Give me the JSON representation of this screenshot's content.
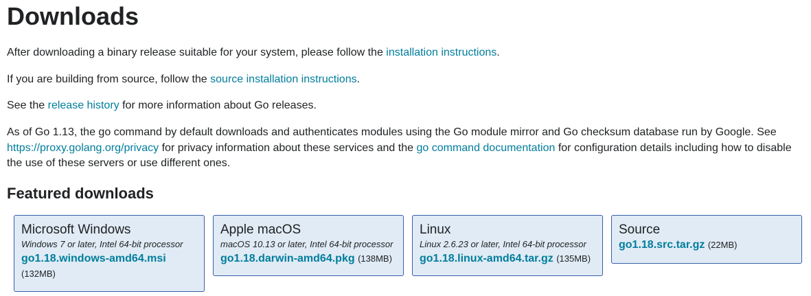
{
  "page_title": "Downloads",
  "intro": {
    "before": "After downloading a binary release suitable for your system, please follow the ",
    "link": "installation instructions",
    "after": "."
  },
  "source": {
    "before": "If you are building from source, follow the ",
    "link": "source installation instructions",
    "after": "."
  },
  "history": {
    "before": "See the ",
    "link": "release history",
    "after": " for more information about Go releases."
  },
  "modules": {
    "part1": "As of Go 1.13, the go command by default downloads and authenticates modules using the Go module mirror and Go checksum database run by Google. See ",
    "link1": "https://proxy.golang.org/privacy",
    "part2": " for privacy information about these services and the ",
    "link2": "go command documentation",
    "part3": " for configuration details including how to disable the use of these servers or use different ones."
  },
  "featured_heading": "Featured downloads",
  "cards": [
    {
      "title": "Microsoft Windows",
      "subtitle": "Windows 7 or later, Intel 64-bit processor",
      "file": "go1.18.windows-amd64.msi",
      "size": "(132MB)"
    },
    {
      "title": "Apple macOS",
      "subtitle": "macOS 10.13 or later, Intel 64-bit processor",
      "file": "go1.18.darwin-amd64.pkg",
      "size": "(138MB)"
    },
    {
      "title": "Linux",
      "subtitle": "Linux 2.6.23 or later, Intel 64-bit processor",
      "file": "go1.18.linux-amd64.tar.gz",
      "size": "(135MB)"
    },
    {
      "title": "Source",
      "subtitle": "",
      "file": "go1.18.src.tar.gz",
      "size": "(22MB)"
    }
  ]
}
